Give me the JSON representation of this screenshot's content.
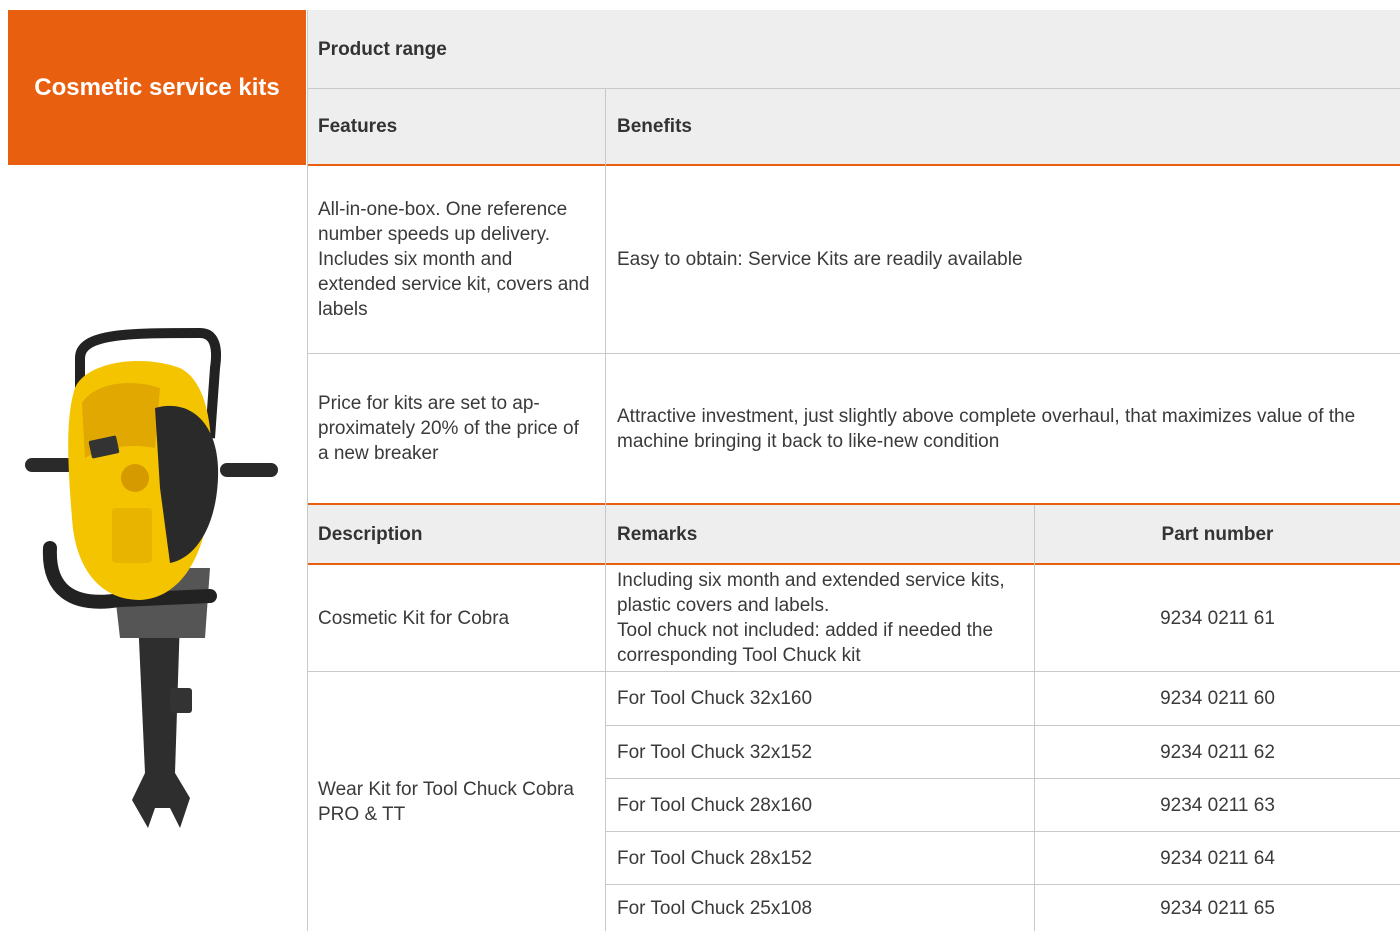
{
  "title": "Cosmetic service kits",
  "product_range_label": "Product range",
  "features_header": "Features",
  "benefits_header": "Benefits",
  "features_rows": [
    {
      "feature": "All-in-one-box. One reference number speeds up delivery. Includes six month and extended service kit, covers and labels",
      "benefit": "Easy to obtain: Service Kits are readily available"
    },
    {
      "feature": "Price for kits are set to ap-proximately 20% of the price of a new breaker",
      "benefit": "Attractive investment, just slightly above complete overhaul, that maximizes value of the machine bringing it back to like-new condition"
    }
  ],
  "parts_headers": {
    "description": "Description",
    "remarks": "Remarks",
    "part_number": "Part number"
  },
  "parts": {
    "cosmetic": {
      "description": "Cosmetic Kit for Cobra",
      "remarks": "Including six month and extended service kits, plastic covers and labels.\nTool chuck not included: added if needed the corresponding Tool Chuck kit",
      "part_number": "9234 0211 61"
    },
    "wear": {
      "description": "Wear Kit for Tool Chuck Cobra PRO & TT",
      "rows": [
        {
          "remarks": "For Tool Chuck 32x160",
          "part_number": "9234 0211 60"
        },
        {
          "remarks": "For Tool Chuck 32x152",
          "part_number": "9234 0211 62"
        },
        {
          "remarks": "For Tool Chuck 28x160",
          "part_number": "9234 0211 63"
        },
        {
          "remarks": "For Tool Chuck 28x152",
          "part_number": "9234 0211 64"
        },
        {
          "remarks": "For Tool Chuck 25x108",
          "part_number": "9234 0211 65"
        }
      ]
    }
  },
  "colors": {
    "accent": "#e8600f",
    "header_bg": "#eeeeee",
    "machine_yellow": "#f5c400",
    "machine_dark": "#2b2b2b"
  }
}
